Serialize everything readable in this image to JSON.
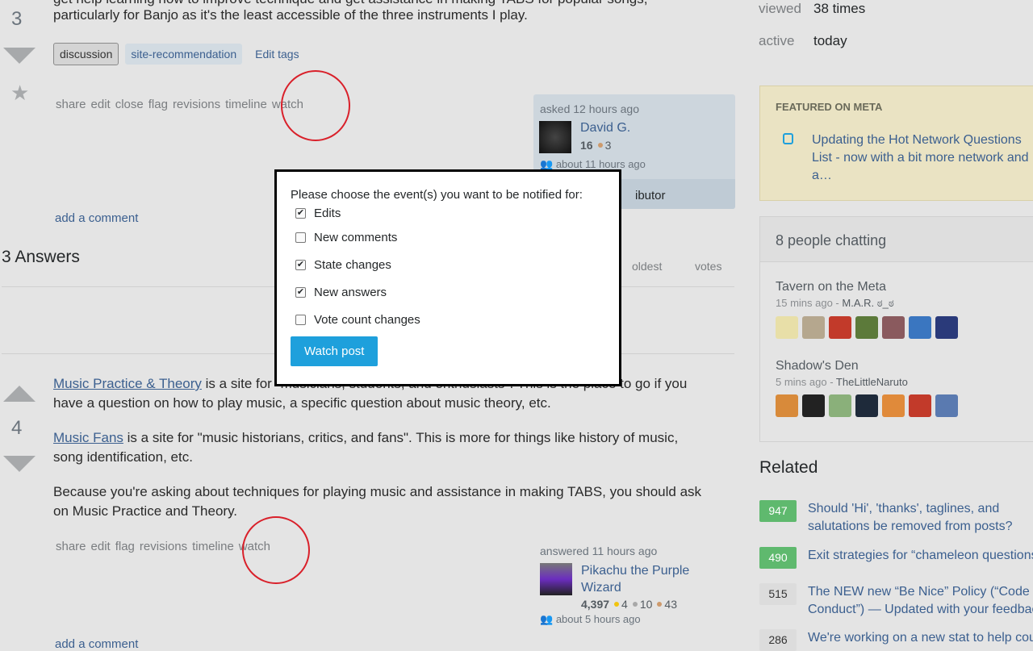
{
  "question": {
    "body_line1": "get help learning how to improve technique and get assistance in making TABS for popular songs,",
    "body_line2": "particularly for Banjo as it's the least accessible of the three instruments I play.",
    "votes": "3",
    "tags": [
      "discussion",
      "site-recommendation"
    ],
    "edit_tags": "Edit tags",
    "menu": [
      "share",
      "edit",
      "close",
      "flag",
      "revisions",
      "timeline",
      "watch"
    ],
    "asked": "asked 12 hours ago",
    "user": "David G.",
    "rep": "16",
    "bronze": "3",
    "last_seen": "about 11 hours ago",
    "contributor_fragment": "ibutor",
    "add_comment": "add a comment"
  },
  "answers_header": {
    "title": "3 Answers",
    "sort": [
      "oldest",
      "votes"
    ]
  },
  "answer": {
    "votes": "4",
    "p1_link": "Music Practice & Theory",
    "p1_rest": " is a site for \"musicians, students, and enthusiasts\". This is the place to go if you have a question on how to play music, a specific question about music theory, etc.",
    "p2_link": "Music Fans",
    "p2_rest": " is a site for \"music historians, critics, and fans\". This is more for things like history of music, song identification, etc.",
    "p3": "Because you're asking about techniques for playing music and assistance in making TABS, you should ask on Music Practice and Theory.",
    "menu": [
      "share",
      "edit",
      "flag",
      "revisions",
      "timeline",
      "watch"
    ],
    "answered": "answered 11 hours ago",
    "user": "Pikachu the Purple Wizard",
    "rep": "4,397",
    "gold": "4",
    "silver": "10",
    "bronze": "43",
    "last_seen": "about 5 hours ago",
    "add_comment": "add a comment"
  },
  "modal": {
    "prompt": "Please choose the event(s) you want to be notified for:",
    "options": [
      {
        "label": "Edits",
        "checked": true
      },
      {
        "label": "New comments",
        "checked": false
      },
      {
        "label": "State changes",
        "checked": true
      },
      {
        "label": "New answers",
        "checked": true
      },
      {
        "label": "Vote count changes",
        "checked": false
      }
    ],
    "button": "Watch post"
  },
  "sidebar": {
    "viewed_label": "viewed",
    "viewed": "38 times",
    "active_label": "active",
    "active": "today",
    "featured_title": "FEATURED ON META",
    "featured_link": "Updating the Hot Network Questions List - now with a bit more network and a…",
    "chat_title": "8 people chatting",
    "rooms": [
      {
        "name": "Tavern on the Meta",
        "time": "15 mins ago - ",
        "user": "M.A.R. ಠ_ಠ"
      },
      {
        "name": "Shadow's Den",
        "time": "5 mins ago - ",
        "user": "TheLittleNaruto"
      }
    ],
    "related_title": "Related",
    "related": [
      {
        "score": "947",
        "title": "Should 'Hi', 'thanks', taglines, and salutations be removed from posts?",
        "accepted": true
      },
      {
        "score": "490",
        "title": "Exit strategies for “chameleon questions”",
        "accepted": true
      },
      {
        "score": "515",
        "title": "The NEW new “Be Nice” Policy (“Code of Conduct”) — Updated with your feedback",
        "accepted": false
      },
      {
        "score": "286",
        "title": "We're working on a new stat to help count",
        "accepted": false
      }
    ]
  },
  "colors": {
    "accent": "#1ea0dc",
    "link": "#3b5f8f",
    "accepted": "#5fb96e",
    "annotation": "#d9202a"
  }
}
